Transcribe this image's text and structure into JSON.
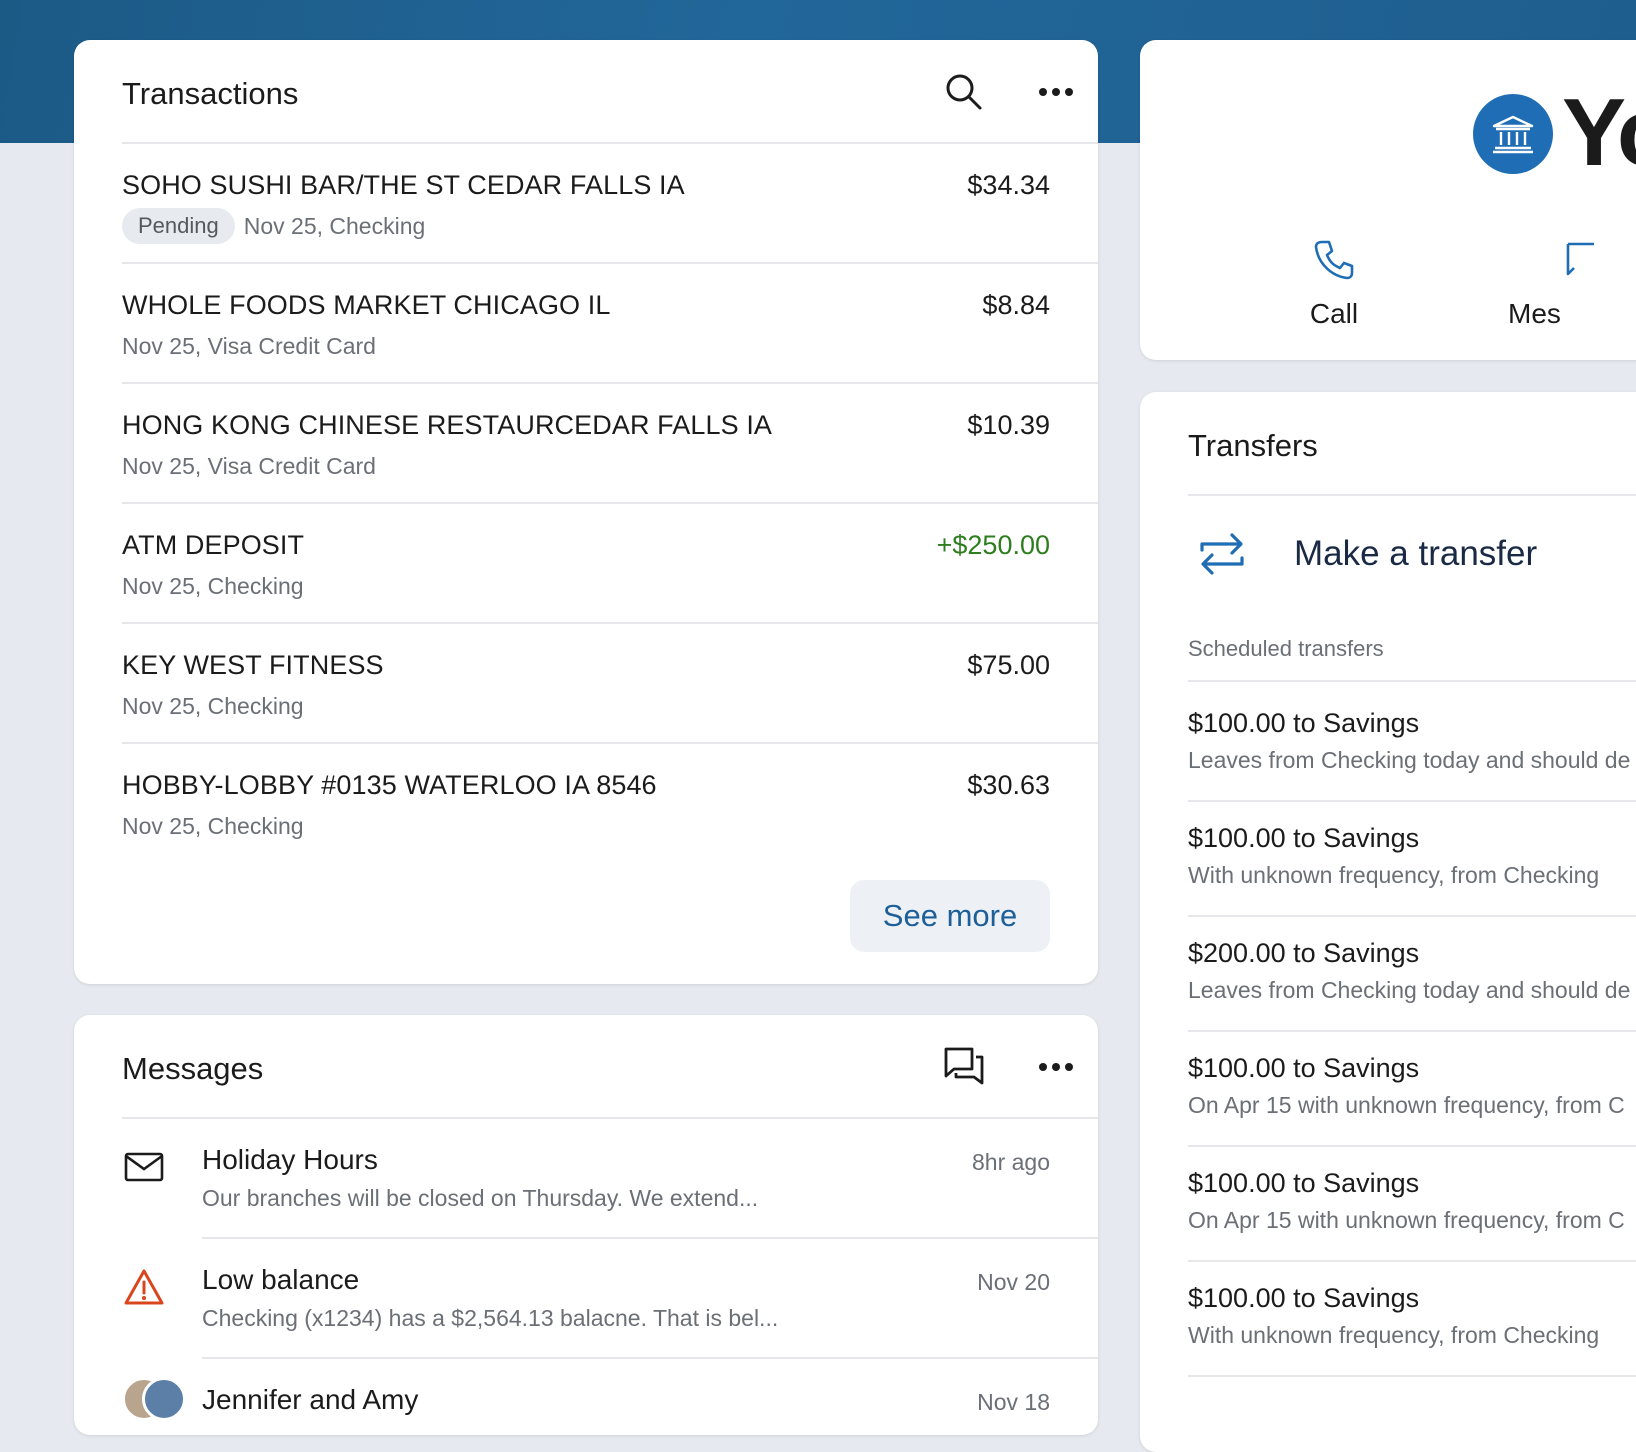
{
  "transactions": {
    "title": "Transactions",
    "items": [
      {
        "name": "SOHO SUSHI BAR/THE ST CEDAR FALLS IA",
        "badge": "Pending",
        "detail": "Nov 25, Checking",
        "amount": "$34.34"
      },
      {
        "name": "WHOLE FOODS MARKET CHICAGO IL",
        "detail": "Nov 25, Visa Credit Card",
        "amount": "$8.84"
      },
      {
        "name": "HONG KONG CHINESE RESTAURCEDAR FALLS IA",
        "detail": "Nov 25, Visa Credit Card",
        "amount": "$10.39"
      },
      {
        "name": "ATM DEPOSIT",
        "detail": "Nov 25, Checking",
        "amount": "+$250.00"
      },
      {
        "name": "KEY WEST FITNESS",
        "detail": "Nov 25, Checking",
        "amount": "$75.00"
      },
      {
        "name": "HOBBY-LOBBY #0135 WATERLOO IA 8546",
        "detail": "Nov 25, Checking",
        "amount": "$30.63"
      }
    ],
    "see_more": "See more"
  },
  "messages": {
    "title": "Messages",
    "items": [
      {
        "title": "Holiday Hours",
        "preview": "Our branches will be closed on Thursday. We extend...",
        "time": "8hr ago"
      },
      {
        "title": "Low balance",
        "preview": "Checking (x1234) has a $2,564.13 balacne. That is bel...",
        "time": "Nov 20"
      },
      {
        "title": "Jennifer and Amy",
        "time": "Nov 18"
      }
    ]
  },
  "bank": {
    "name": "Yo",
    "actions": [
      "Call",
      "Mes"
    ]
  },
  "transfers": {
    "title": "Transfers",
    "make_transfer": "Make a transfer",
    "scheduled_label": "Scheduled transfers",
    "items": [
      {
        "title": "$100.00 to Savings",
        "detail": "Leaves from Checking today and should de"
      },
      {
        "title": "$100.00 to Savings",
        "detail": "With unknown frequency, from Checking"
      },
      {
        "title": "$200.00 to Savings",
        "detail": "Leaves from Checking today and should de"
      },
      {
        "title": "$100.00 to Savings",
        "detail": "On Apr 15 with unknown frequency, from C"
      },
      {
        "title": "$100.00 to Savings",
        "detail": "On Apr 15 with unknown frequency, from C"
      },
      {
        "title": "$100.00 to Savings",
        "detail": "With unknown frequency, from Checking"
      }
    ]
  },
  "colors": {
    "banner": "#1e5e8e",
    "accent": "#1d5f98",
    "credit": "#2e7d1e",
    "warning": "#d9461c"
  }
}
